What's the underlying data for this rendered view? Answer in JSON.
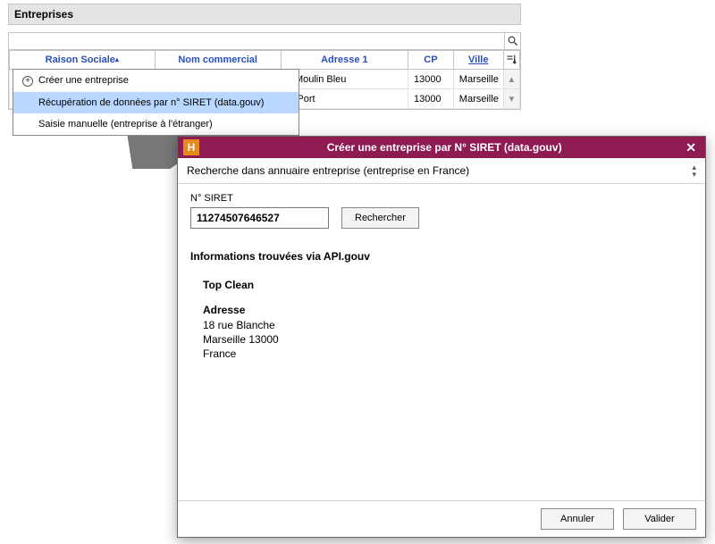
{
  "panel": {
    "title": "Entreprises",
    "columns": {
      "raison": "Raison Sociale",
      "nom": "Nom commercial",
      "adresse": "Adresse 1",
      "cp": "CP",
      "ville": "Ville"
    },
    "rows": [
      {
        "adresse": "u Moulin Bleu",
        "cp": "13000",
        "ville": "Marseille"
      },
      {
        "adresse": "lu Port",
        "cp": "13000",
        "ville": "Marseille"
      }
    ]
  },
  "contextMenu": {
    "header": "Créer une entreprise",
    "opt1": "Récupération de données par n° SIRET (data.gouv)",
    "opt2": "Saisie manuelle (entreprise à l'étranger)"
  },
  "modal": {
    "title": "Créer une entreprise par N° SIRET (data.gouv)",
    "sub": "Recherche dans annuaire entreprise (entreprise en France)",
    "siretLabel": "N° SIRET",
    "siretValue": "11274507646527",
    "searchBtn": "Rechercher",
    "infoHead": "Informations trouvées via API.gouv",
    "companyName": "Top Clean",
    "addressLabel": "Adresse",
    "addr1": "18 rue Blanche",
    "addr2": "Marseille 13000",
    "addr3": "France",
    "cancel": "Annuler",
    "validate": "Valider"
  }
}
